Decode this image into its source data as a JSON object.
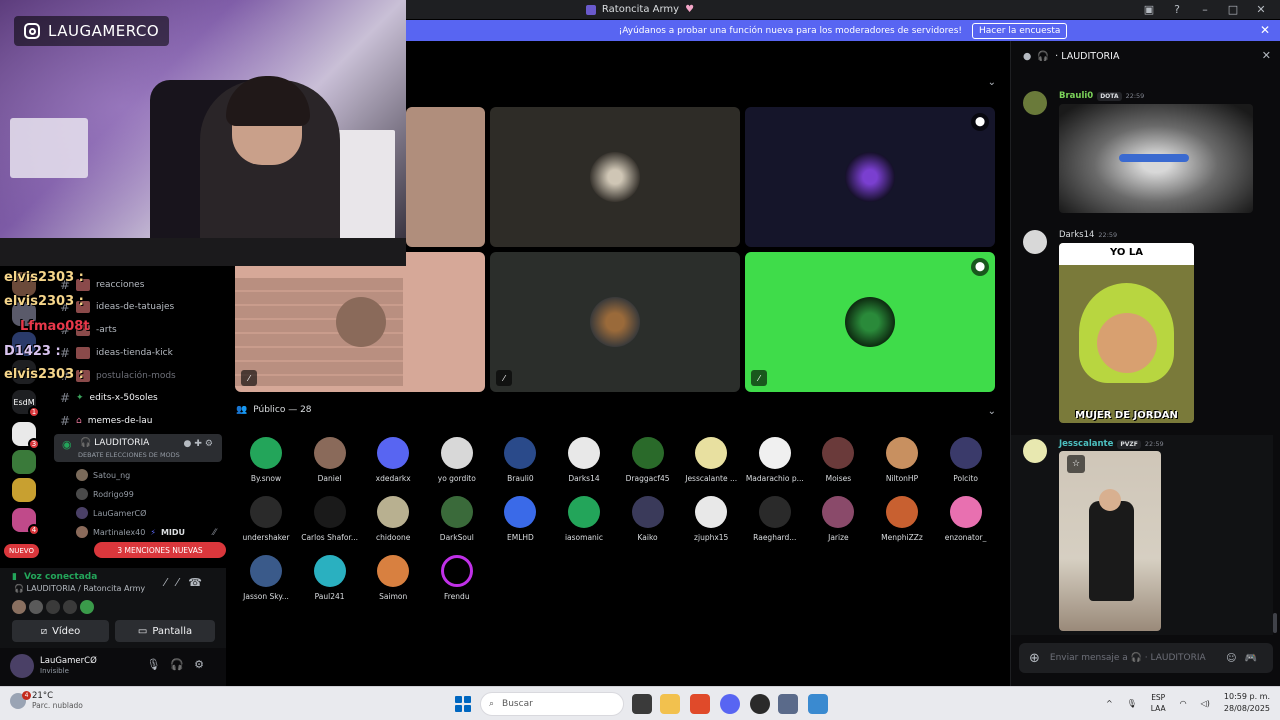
{
  "window": {
    "title": "Ratoncita Army"
  },
  "banner": {
    "text": "¡Ayúdanos a probar una función nueva para los moderadores de servidores!",
    "button": "Hacer la encuesta"
  },
  "stream": {
    "brand": "LAUGAMERCO",
    "chat_overlay": [
      "elvis2303 :",
      "elvis2303 :",
      "Lfmao08t",
      "D1423 :",
      "elvis2303 :"
    ]
  },
  "rail": {
    "label": "EsdM"
  },
  "channels": [
    {
      "name": "reacciones"
    },
    {
      "name": "ideas-de-tatuajes"
    },
    {
      "name": "-arts"
    },
    {
      "name": "ideas-tienda-kick"
    },
    {
      "name": "postulación-mods"
    },
    {
      "name": "edits-x-50soles"
    },
    {
      "name": "memes-de-lau"
    }
  ],
  "voice_channel": {
    "name": "LAUDITORIA",
    "subtitle": "DEBATE ELECCIONES DE MODS",
    "users": [
      "Satou_ng",
      "Rodrigo99",
      "LauGamerCØ",
      "Martinalex40",
      "MIDU"
    ]
  },
  "pills": {
    "new": "NUEVO",
    "mentions": "3 MENCIONES NUEVAS"
  },
  "voice_panel": {
    "status": "Voz conectada",
    "channel": "LAUDITORIA / Ratoncita Army",
    "video": "Vídeo",
    "screen": "Pantalla"
  },
  "user": {
    "name": "LauGamerCØ",
    "status": "Invisible"
  },
  "public": {
    "heading": "Público — 28",
    "members": [
      "By.snow",
      "Daniel",
      "xdedarkx",
      "yo gordito",
      "Brauli0",
      "Darks14",
      "Draggacf45",
      "Jesscalante ...",
      "Madarachio p...",
      "Moises",
      "NiltonHP",
      "Polcito",
      "undershaker",
      "Carlos Shafor...",
      "chidoone",
      "DarkSoul",
      "EMLHD",
      "iasomanic",
      "Kaiko",
      "zjuphx15",
      "Raeghard...",
      "Jarize",
      "MenphiZZz",
      "enzonator_",
      "Jasson Sky...",
      "Paul241",
      "Saimon",
      "Frendu"
    ]
  },
  "chat": {
    "header": "LAUDITORIA",
    "messages": [
      {
        "author": "Brauli0",
        "tag": "DOTA",
        "time": "22:59"
      },
      {
        "author": "Darks14",
        "time": "22:59",
        "image_top": "YO LA",
        "image_bottom": "MUJER DE JORDAN"
      },
      {
        "author": "Jesscalante",
        "tag": "PVZF",
        "time": "22:59"
      }
    ],
    "input_placeholder": "Enviar mensaje a",
    "input_channel": "LAUDITORIA"
  },
  "taskbar": {
    "temp": "21°C",
    "condition": "Parc. nublado",
    "badge": "4",
    "search": "Buscar",
    "lang_1": "ESP",
    "lang_2": "LAA",
    "time": "10:59 p. m.",
    "date": "28/08/2025"
  },
  "colors": {
    "accent": "#5865f2",
    "green": "#23a55a",
    "red": "#da373c"
  }
}
